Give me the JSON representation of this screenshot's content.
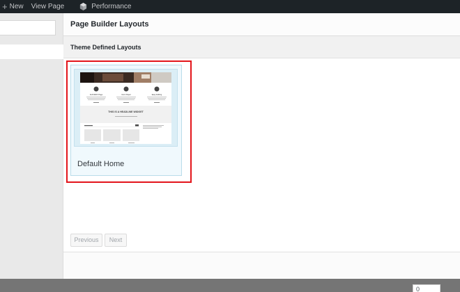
{
  "admin_bar": {
    "new_icon": "plus-icon",
    "new_label": "New",
    "view_page_label": "View Page",
    "performance_icon": "performance-icon",
    "performance_label": "Performance",
    "bg_color": "#1d2327"
  },
  "dialog": {
    "title": "Page Builder Layouts",
    "section_title": "Theme Defined Layouts",
    "layouts": [
      {
        "name": "Default Home",
        "thumbnail": {
          "columns": [
            {
              "title": "Full Width Page"
            },
            {
              "title": "Ink & Paper"
            },
            {
              "title": "Easy Editing"
            }
          ],
          "headline": "THIS IS A HEADLINE WIDGET"
        }
      }
    ],
    "pagination": {
      "previous_label": "Previous",
      "next_label": "Next"
    },
    "page_value": "0",
    "highlight_color": "#e3141a"
  }
}
